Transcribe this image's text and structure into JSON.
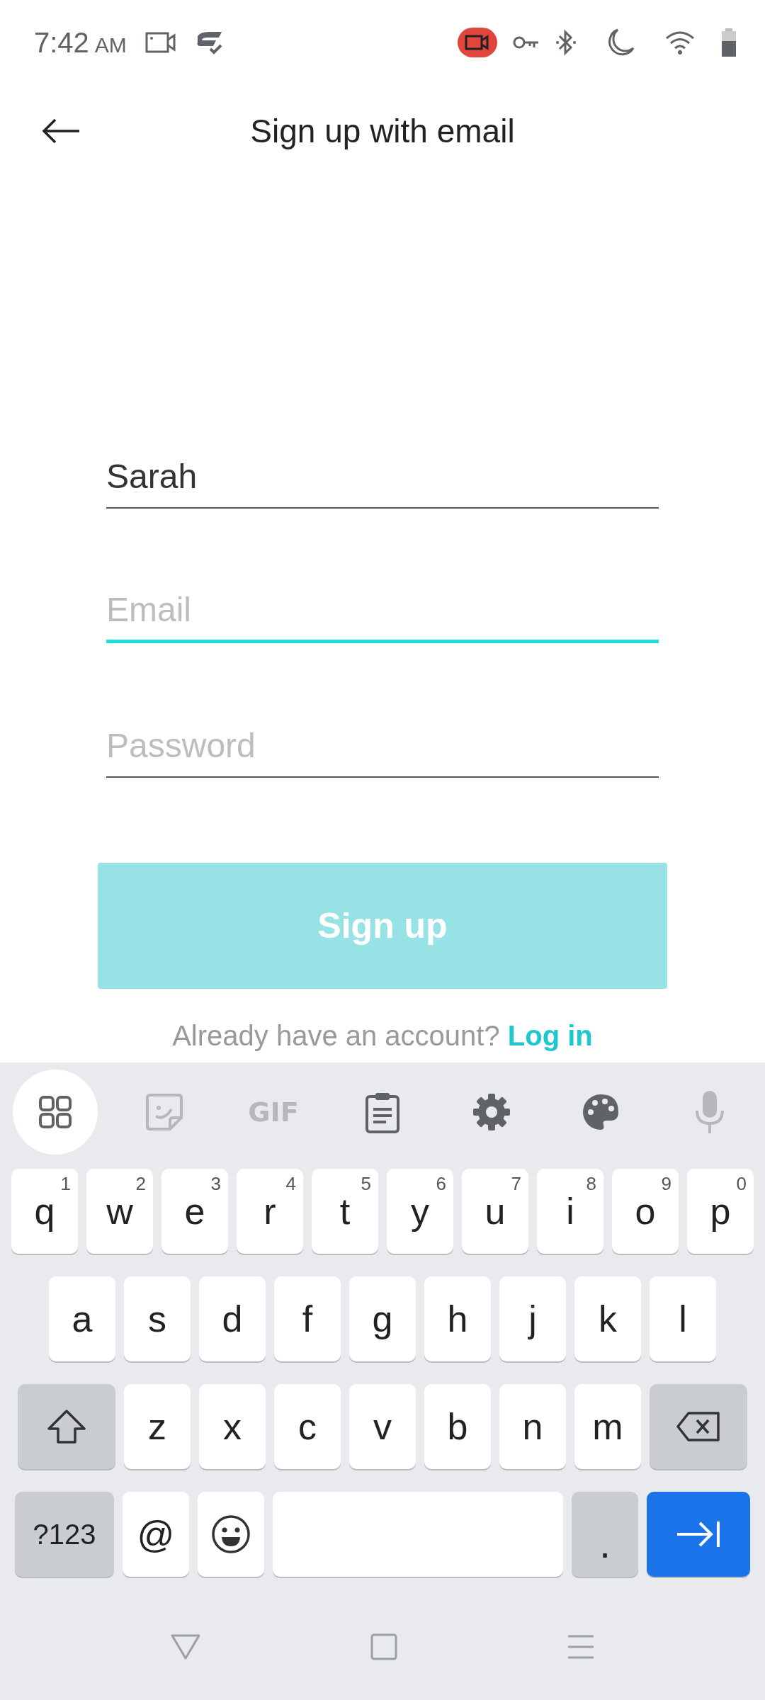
{
  "status_bar": {
    "time": "7:42",
    "meridiem": "AM"
  },
  "header": {
    "title": "Sign up with email"
  },
  "fields": [
    {
      "value": "Sarah",
      "focused": false
    },
    {
      "placeholder": "Email",
      "focused": true
    },
    {
      "placeholder": "Password",
      "focused": false
    }
  ],
  "signup_button": {
    "label": "Sign up",
    "disabled": true
  },
  "login_prompt": {
    "text": "Already have an account?",
    "link": "Log in"
  },
  "keyboard": {
    "toolbar": [
      {
        "kind": "apps",
        "selected": true,
        "disabled": false
      },
      {
        "kind": "sticker",
        "selected": false,
        "disabled": true
      },
      {
        "kind": "gif",
        "label": "GIF",
        "selected": false,
        "disabled": true
      },
      {
        "kind": "clipboard",
        "selected": false,
        "disabled": false
      },
      {
        "kind": "settings",
        "selected": false,
        "disabled": false
      },
      {
        "kind": "palette",
        "selected": false,
        "disabled": false
      },
      {
        "kind": "mic",
        "selected": false,
        "disabled": true
      }
    ],
    "top_row": [
      {
        "kind": "letter",
        "label": "q",
        "hint": "1"
      },
      {
        "kind": "letter",
        "label": "w",
        "hint": "2"
      },
      {
        "kind": "letter",
        "label": "e",
        "hint": "3"
      },
      {
        "kind": "letter",
        "label": "r",
        "hint": "4"
      },
      {
        "kind": "letter",
        "label": "t",
        "hint": "5"
      },
      {
        "kind": "letter",
        "label": "y",
        "hint": "6"
      },
      {
        "kind": "letter",
        "label": "u",
        "hint": "7"
      },
      {
        "kind": "letter",
        "label": "i",
        "hint": "8"
      },
      {
        "kind": "letter",
        "label": "o",
        "hint": "9"
      },
      {
        "kind": "letter",
        "label": "p",
        "hint": "0"
      }
    ],
    "home_row": [
      {
        "kind": "letter",
        "label": "a"
      },
      {
        "kind": "letter",
        "label": "s"
      },
      {
        "kind": "letter",
        "label": "d"
      },
      {
        "kind": "letter",
        "label": "f"
      },
      {
        "kind": "letter",
        "label": "g"
      },
      {
        "kind": "letter",
        "label": "h"
      },
      {
        "kind": "letter",
        "label": "j"
      },
      {
        "kind": "letter",
        "label": "k"
      },
      {
        "kind": "letter",
        "label": "l"
      }
    ],
    "lower_row": [
      {
        "kind": "shift"
      },
      {
        "kind": "letter",
        "label": "z"
      },
      {
        "kind": "letter",
        "label": "x"
      },
      {
        "kind": "letter",
        "label": "c"
      },
      {
        "kind": "letter",
        "label": "v"
      },
      {
        "kind": "letter",
        "label": "b"
      },
      {
        "kind": "letter",
        "label": "n"
      },
      {
        "kind": "letter",
        "label": "m"
      },
      {
        "kind": "backspace"
      }
    ],
    "bottom_row": [
      {
        "kind": "symbols",
        "label": "?123"
      },
      {
        "kind": "letter",
        "label": "@"
      },
      {
        "kind": "emoji"
      },
      {
        "kind": "space"
      },
      {
        "kind": "period",
        "label": "."
      },
      {
        "kind": "enter"
      }
    ]
  }
}
